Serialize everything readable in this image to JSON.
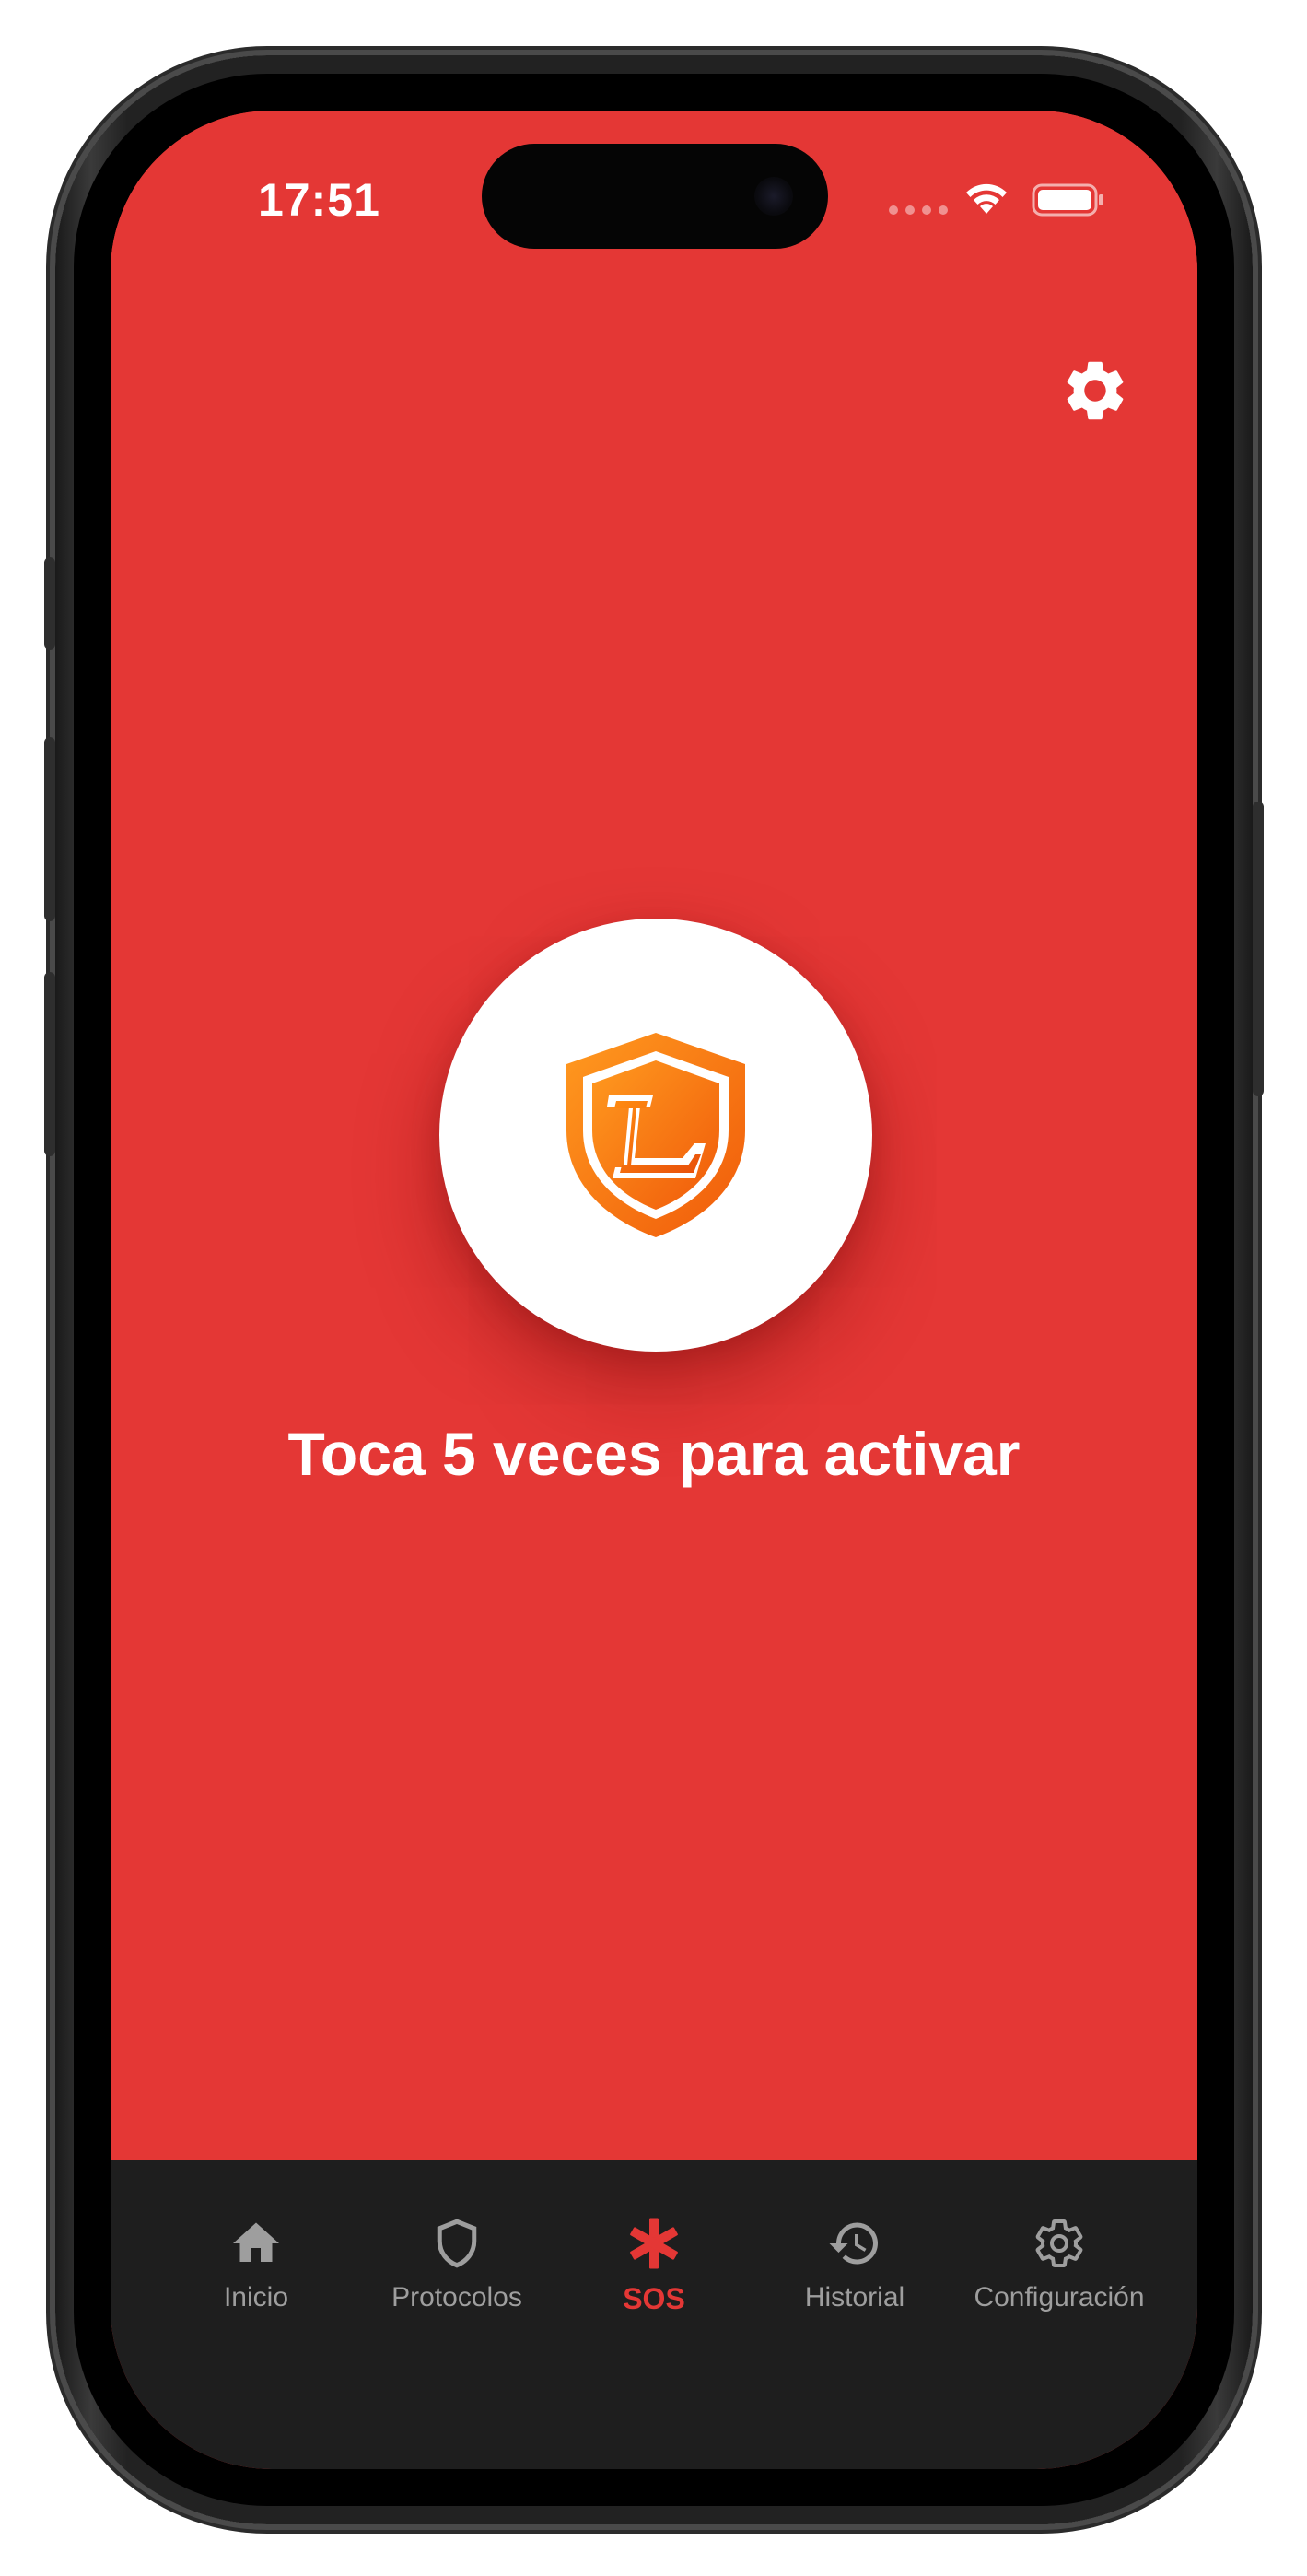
{
  "status_bar": {
    "time": "17:51",
    "icons": [
      "cellular-signal-icon",
      "wifi-icon",
      "battery-icon"
    ]
  },
  "header": {
    "settings_icon": "gear-icon"
  },
  "sos_button": {
    "logo_icon": "shield-L-logo-icon",
    "instruction": "Toca 5 veces para activar"
  },
  "bottom_nav": {
    "items": [
      {
        "label": "Inicio",
        "icon": "home-icon",
        "active": false
      },
      {
        "label": "Protocolos",
        "icon": "shield-icon",
        "active": false
      },
      {
        "label": "SOS",
        "icon": "asterisk-icon",
        "active": true
      },
      {
        "label": "Historial",
        "icon": "history-icon",
        "active": false
      },
      {
        "label": "Configuración",
        "icon": "gear-icon",
        "active": false
      }
    ]
  },
  "colors": {
    "background_red": "#e43735",
    "nav_background": "#1e1e1e",
    "nav_inactive": "#9e9e9e",
    "nav_active": "#e43735",
    "logo_orange": "#f77f0a"
  }
}
